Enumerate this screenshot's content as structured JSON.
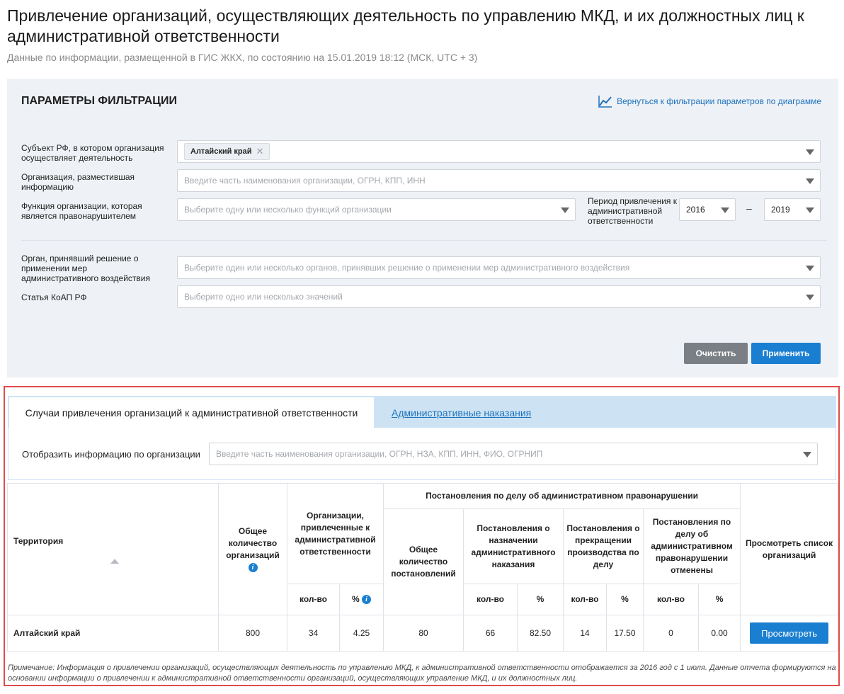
{
  "page": {
    "title": "Привлечение организаций, осуществляющих деятельность по управлению МКД, и их должностных лиц к административной ответственности",
    "subtitle": "Данные по информации, размещенной в ГИС ЖКХ, по состоянию на 15.01.2019 18:12 (МСК, UTC + 3)"
  },
  "filters": {
    "heading": "ПАРАМЕТРЫ ФИЛЬТРАЦИИ",
    "diagram_link": "Вернуться к фильтрации параметров по диаграмме",
    "subject": {
      "label": "Субъект РФ, в котором организация осуществляет деятельность",
      "chip": "Алтайский край"
    },
    "organization": {
      "label": "Организация, разместившая информацию",
      "placeholder": "Введите часть наименования организации, ОГРН, КПП, ИНН"
    },
    "function": {
      "label": "Функция организации, которая является правонарушителем",
      "placeholder": "Выберите одну или несколько функций организации"
    },
    "period": {
      "label": "Период привлечения к административной ответственности",
      "from": "2016",
      "separator": "–",
      "to": "2019"
    },
    "authority": {
      "label": "Орган, принявший решение о применении мер административного воздействия",
      "placeholder": "Выберите один или несколько органов, принявших решение о применении мер административного воздействия"
    },
    "article": {
      "label": "Статья КоАП РФ",
      "placeholder": "Выберите одно или несколько значений"
    },
    "clear_label": "Очистить",
    "apply_label": "Применить"
  },
  "tabs": {
    "active": "Случаи привлечения организаций к административной ответственности",
    "other": "Административные наказания"
  },
  "org_filter": {
    "label": "Отобразить информацию по организации",
    "placeholder": "Введите часть наименования организации, ОГРН, НЗА, КПП, ИНН, ФИО, ОГРНИП"
  },
  "table": {
    "headers": {
      "territory": "Территория",
      "total_orgs": "Общее количество организаций",
      "involved_orgs": "Организации, привлеченные к административной ответственности",
      "resolutions": "Постановления по делу об административном правонарушении",
      "total_resolutions": "Общее количество постановлений",
      "penalty": "Постановления о назначении административного наказания",
      "terminated": "Постановления о прекращении производства по делу",
      "cancelled": "Постановления по делу об административном правонарушении отменены",
      "view_list": "Просмотреть список организаций",
      "count": "кол-во",
      "percent": "%"
    },
    "row": {
      "territory": "Алтайский край",
      "total_orgs": "800",
      "involved_count": "34",
      "involved_pct": "4.25",
      "total_resolutions": "80",
      "penalty_count": "66",
      "penalty_pct": "82.50",
      "terminated_count": "14",
      "terminated_pct": "17.50",
      "cancelled_count": "0",
      "cancelled_pct": "0.00",
      "view_label": "Просмотреть"
    }
  },
  "note": "Примечание: Информация о привлечении организаций, осуществляющих деятельность по управлению МКД, к административной ответственности отображается за 2016 год с 1 июля. Данные отчета формируются на основании информации о привлечении к административной ответственности организаций, осуществляющих управление МКД, и их должностных лиц.",
  "icons": {
    "info": "i"
  },
  "colors": {
    "accent": "#1a7fd1",
    "link": "#1e73be",
    "highlight_border": "#e04b4b",
    "tab_bar": "#cde3f4"
  }
}
